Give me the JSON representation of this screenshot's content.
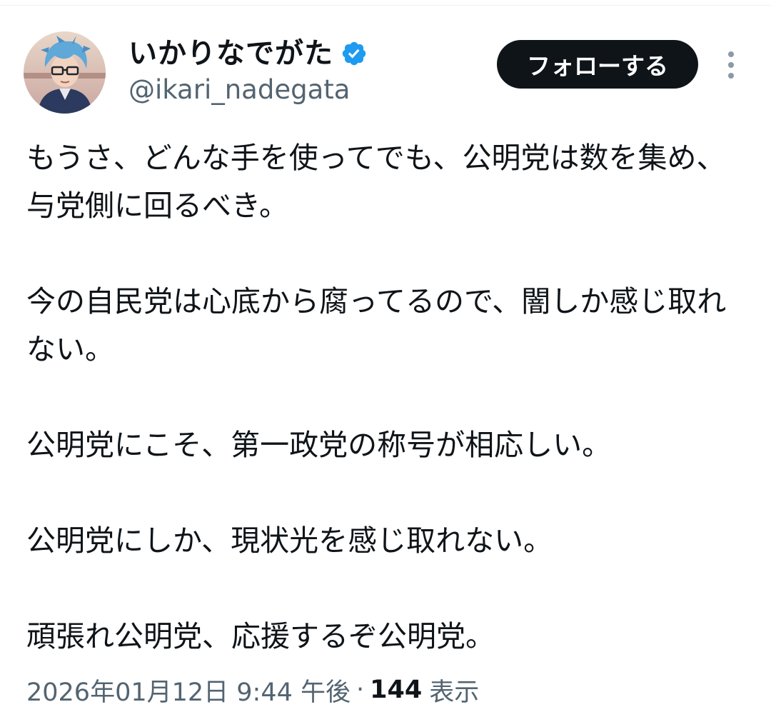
{
  "author": {
    "display_name": "いかりなでがた",
    "handle": "@ikari_nadegata",
    "verified": true,
    "avatar_icon": "anime-avatar-blue-hair-glasses"
  },
  "actions": {
    "follow_label": "フォローする",
    "more_icon": "vertical-ellipsis-icon"
  },
  "tweet": {
    "paragraphs": [
      "もうさ、どんな手を使ってでも、公明党は数を集め、与党側に回るべき。",
      "今の自民党は心底から腐ってるので、闇しか感じ取れない。",
      "公明党にこそ、第一政党の称号が相応しい。",
      "公明党にしか、現状光を感じ取れない。",
      "頑張れ公明党、応援するぞ公明党。"
    ]
  },
  "meta": {
    "timestamp": "2026年01月12日 9:44 午後",
    "separator": "·",
    "views_count": "144",
    "views_label": "表示"
  },
  "colors": {
    "verified_blue": "#1d9bf0",
    "follow_bg": "#0f1419",
    "secondary_text": "#536471"
  }
}
